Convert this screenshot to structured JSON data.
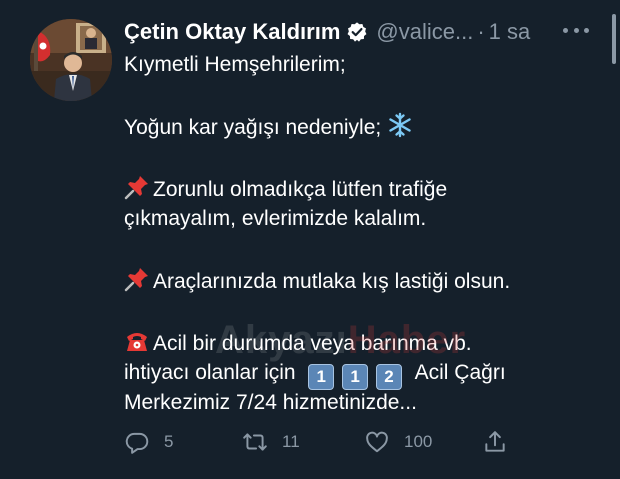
{
  "author": {
    "name": "Çetin Oktay Kaldırım",
    "handle": "@valice...",
    "separator": "·",
    "time": "1 sa"
  },
  "icons": {
    "verified": "verified-badge-icon",
    "more": "more-options-icon",
    "reply": "reply-icon",
    "retweet": "retweet-icon",
    "like": "like-icon",
    "share": "share-icon"
  },
  "tweet": {
    "greeting": "Kıymetli Hemşehrilerim;",
    "line2": "Yoğun kar yağışı nedeniyle;",
    "line3a": "Zorunlu olmadıkça lütfen trafiğe",
    "line3b": "çıkmayalım, evlerimizde kalalım.",
    "line4": "Araçlarınızda mutlaka kış lastiği olsun.",
    "line5a": "Acil bir durumda veya barınma vb.",
    "line5b_prefix": "ihtiyacı olanlar için",
    "keycaps": [
      "1",
      "1",
      "2"
    ],
    "line5b_suffix": "Acil Çağrı",
    "line5c": "Merkezimiz 7/24 hizmetinizde..."
  },
  "watermark": {
    "part1": "Akyazı",
    "part2": "Haber"
  },
  "stats": {
    "replies": "5",
    "retweets": "11",
    "likes": "100"
  },
  "colors": {
    "background": "#15202b",
    "secondary_text": "#8b98a5",
    "verified_badge": "#ffffff"
  }
}
